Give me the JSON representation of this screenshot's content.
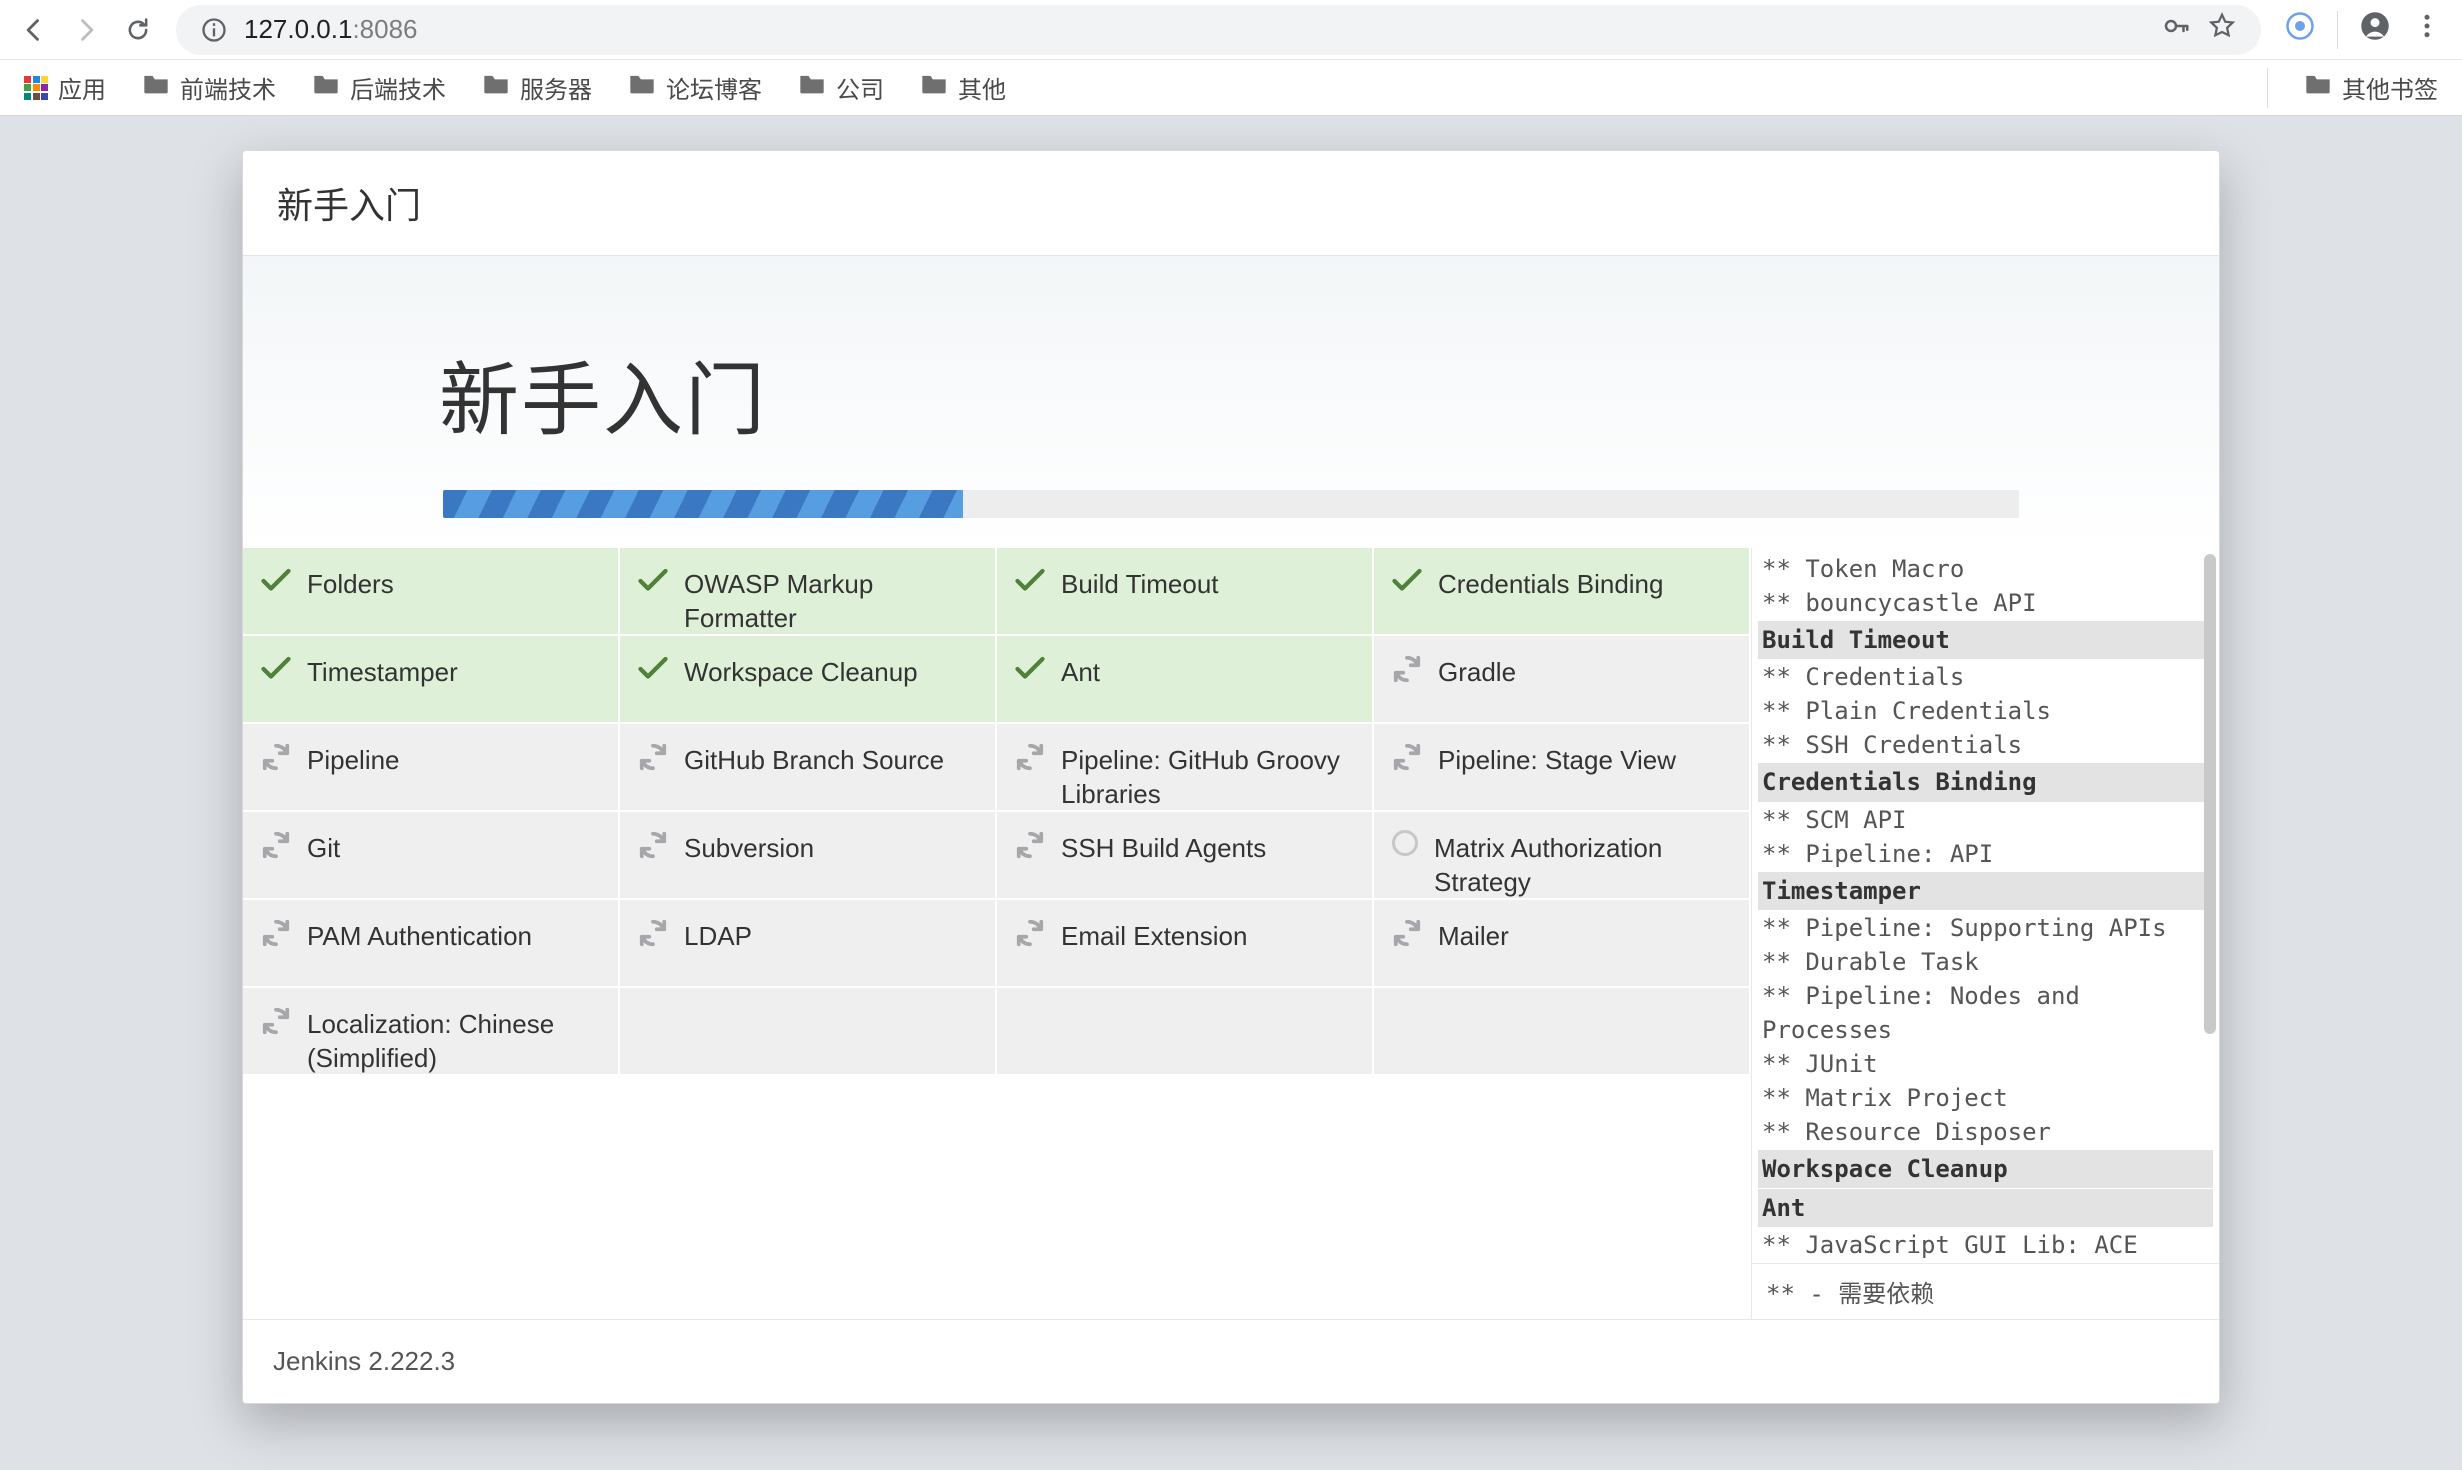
{
  "browser": {
    "url_info_tooltip": "Site information",
    "url_host": "127.0.0.1",
    "url_port": ":8086"
  },
  "bookmarks": {
    "apps": "应用",
    "items": [
      "前端技术",
      "后端技术",
      "服务器",
      "论坛博客",
      "公司",
      "其他"
    ],
    "other": "其他书签"
  },
  "wizard": {
    "header": "新手入门",
    "title": "新手入门",
    "footer": "Jenkins 2.222.3"
  },
  "plugins": [
    {
      "name": "Folders",
      "state": "done"
    },
    {
      "name": "OWASP Markup Formatter",
      "state": "done"
    },
    {
      "name": "Build Timeout",
      "state": "done"
    },
    {
      "name": "Credentials Binding",
      "state": "done"
    },
    {
      "name": "Timestamper",
      "state": "done"
    },
    {
      "name": "Workspace Cleanup",
      "state": "done"
    },
    {
      "name": "Ant",
      "state": "done"
    },
    {
      "name": "Gradle",
      "state": "loading"
    },
    {
      "name": "Pipeline",
      "state": "loading"
    },
    {
      "name": "GitHub Branch Source",
      "state": "loading"
    },
    {
      "name": "Pipeline: GitHub Groovy Libraries",
      "state": "loading"
    },
    {
      "name": "Pipeline: Stage View",
      "state": "loading"
    },
    {
      "name": "Git",
      "state": "loading"
    },
    {
      "name": "Subversion",
      "state": "loading"
    },
    {
      "name": "SSH Build Agents",
      "state": "loading"
    },
    {
      "name": "Matrix Authorization Strategy",
      "state": "pending"
    },
    {
      "name": "PAM Authentication",
      "state": "loading"
    },
    {
      "name": "LDAP",
      "state": "loading"
    },
    {
      "name": "Email Extension",
      "state": "loading"
    },
    {
      "name": "Mailer",
      "state": "loading"
    },
    {
      "name": "Localization: Chinese (Simplified)",
      "state": "loading"
    }
  ],
  "log": {
    "rows": [
      {
        "t": "dep",
        "text": "** Token Macro"
      },
      {
        "t": "dep",
        "text": "** bouncycastle API"
      },
      {
        "t": "hdr",
        "text": "Build Timeout"
      },
      {
        "t": "dep",
        "text": "** Credentials"
      },
      {
        "t": "dep",
        "text": "** Plain Credentials"
      },
      {
        "t": "dep",
        "text": "** SSH Credentials"
      },
      {
        "t": "hdr",
        "text": "Credentials Binding"
      },
      {
        "t": "dep",
        "text": "** SCM API"
      },
      {
        "t": "dep",
        "text": "** Pipeline: API"
      },
      {
        "t": "hdr",
        "text": "Timestamper"
      },
      {
        "t": "dep",
        "text": "** Pipeline: Supporting APIs"
      },
      {
        "t": "dep",
        "text": "** Durable Task"
      },
      {
        "t": "dep",
        "text": "** Pipeline: Nodes and Processes"
      },
      {
        "t": "dep",
        "text": "** JUnit"
      },
      {
        "t": "dep",
        "text": "** Matrix Project"
      },
      {
        "t": "dep",
        "text": "** Resource Disposer"
      },
      {
        "t": "hdr",
        "text": "Workspace Cleanup"
      },
      {
        "t": "hdr",
        "text": "Ant"
      },
      {
        "t": "dep",
        "text": "** JavaScript GUI Lib: ACE Editor bundle"
      }
    ],
    "footer": "** - 需要依赖"
  },
  "progress_percent": 33
}
